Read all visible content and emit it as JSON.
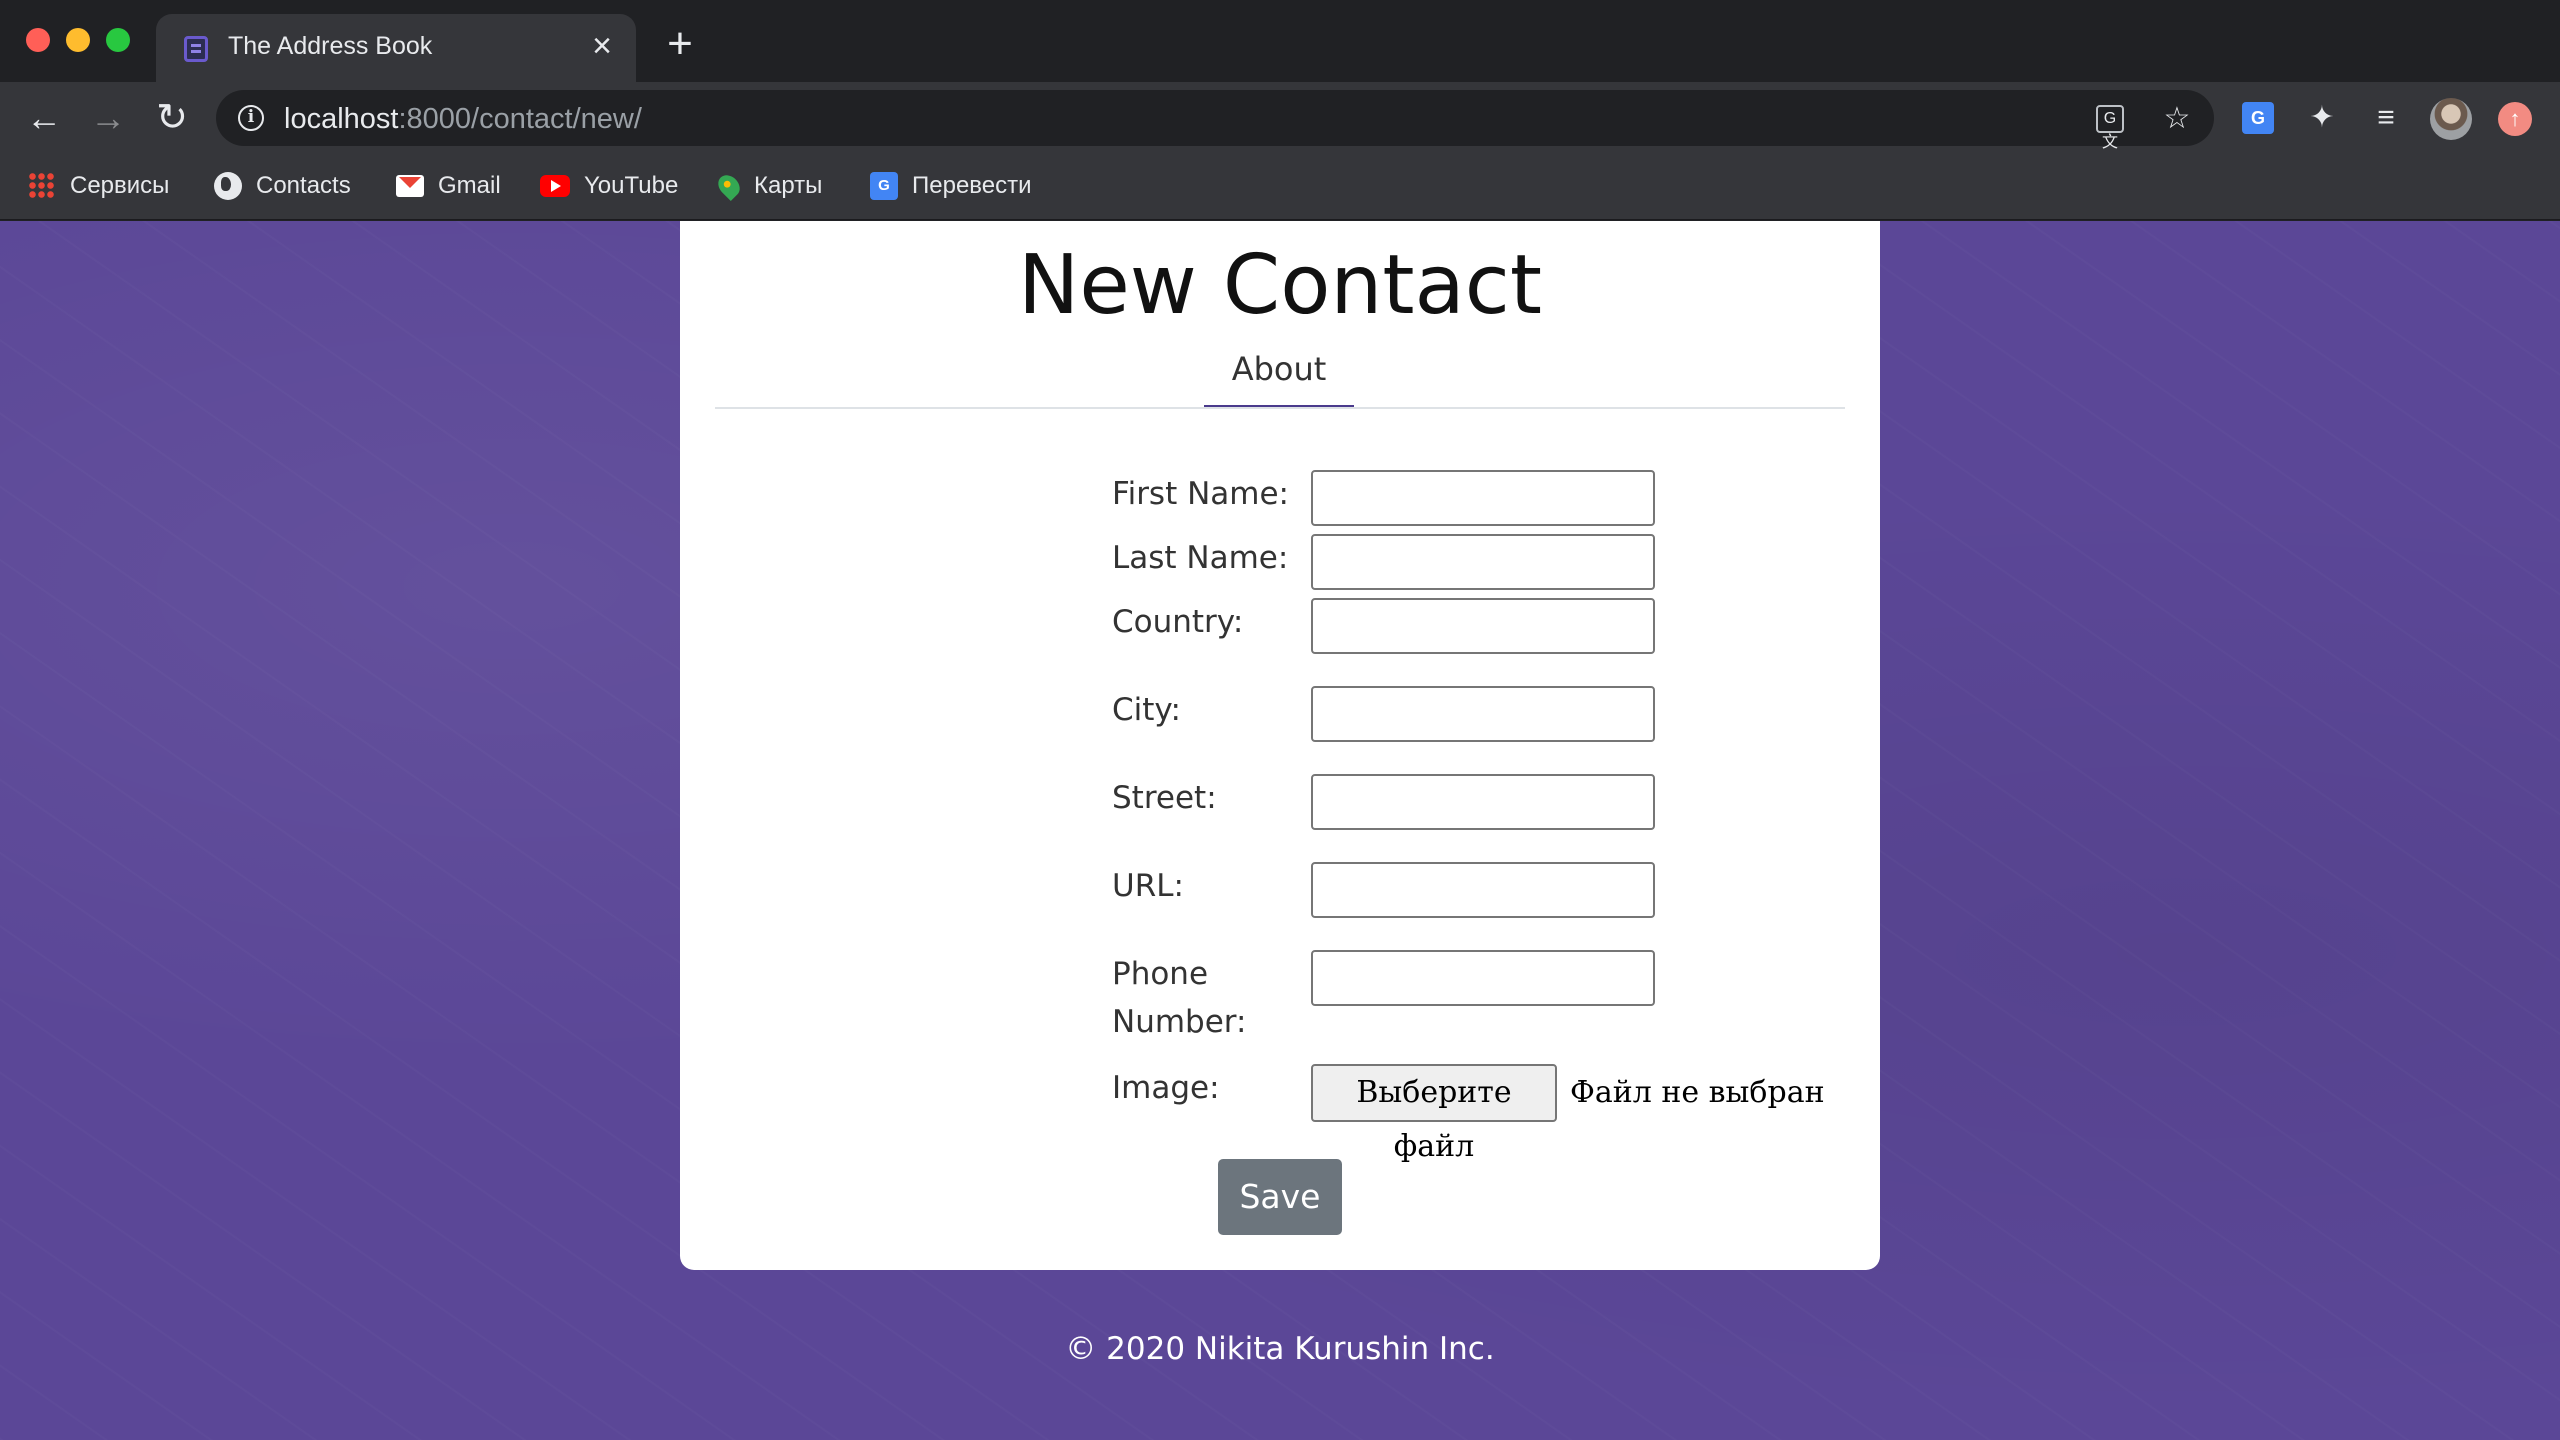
{
  "browser": {
    "tab_title": "The Address Book",
    "url_host": "localhost",
    "url_rest": ":8000/contact/new/",
    "bookmarks": [
      {
        "label": "Сервисы",
        "icon": "apps-grid-icon"
      },
      {
        "label": "Contacts",
        "icon": "globe-icon"
      },
      {
        "label": "Gmail",
        "icon": "gmail-icon"
      },
      {
        "label": "YouTube",
        "icon": "youtube-icon"
      },
      {
        "label": "Карты",
        "icon": "maps-pin-icon"
      },
      {
        "label": "Перевести",
        "icon": "google-translate-icon"
      }
    ]
  },
  "page": {
    "title": "New Contact",
    "tab_label": "About",
    "fields": [
      {
        "label": "First Name:",
        "value": ""
      },
      {
        "label": "Last Name:",
        "value": ""
      },
      {
        "label": "Country:",
        "value": ""
      },
      {
        "label": "City:",
        "value": ""
      },
      {
        "label": "Street:",
        "value": ""
      },
      {
        "label": "URL:",
        "value": ""
      },
      {
        "label": "Phone Number:",
        "value": ""
      }
    ],
    "image_label": "Image:",
    "file_button": "Выберите файл",
    "file_status": "Файл не выбран",
    "save_label": "Save",
    "footer": "© 2020 Nikita Kurushin Inc."
  },
  "colors": {
    "background": "#5b4797",
    "accent": "#4a3a8c",
    "save_button": "#6c757d"
  }
}
